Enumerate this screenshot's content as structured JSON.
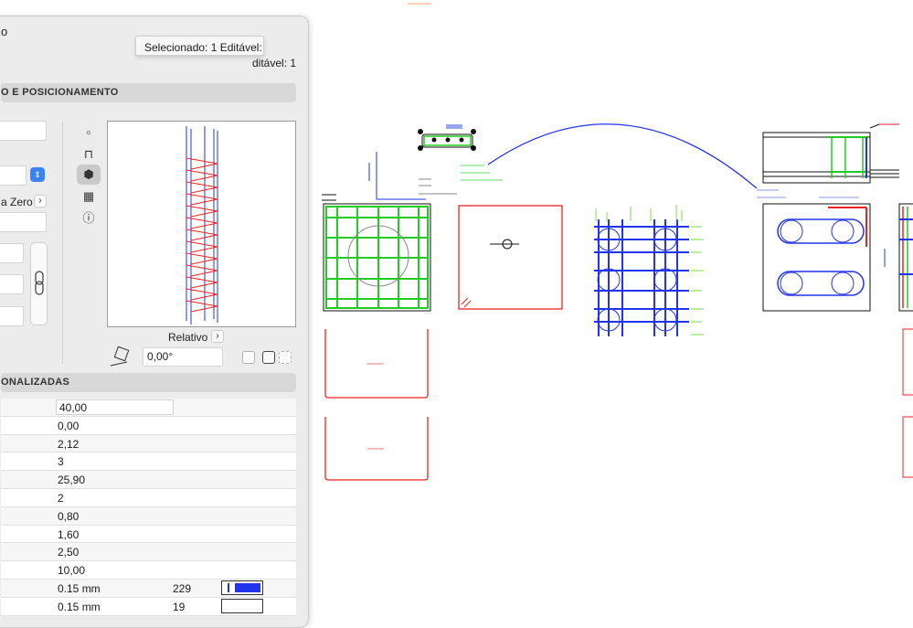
{
  "palette": {
    "window": "#ececec",
    "header": "#d8d8d8",
    "rebar_blue": "#2233ee",
    "rebar_green": "#22cc22",
    "rebar_red": "#ee2222"
  },
  "panel": {
    "title": "o",
    "tooltip": "Selecionado: 1 Editável:",
    "editable_status": "ditável: 1",
    "section_positioning": "O E POSICIONAMENTO",
    "set_zero_label": "a Zero",
    "relative_label": "Relativo",
    "angle_value": "0,00°",
    "section_custom": "ONALIZADAS",
    "toolbar_icons": [
      "square-icon",
      "floor-plan-icon",
      "3d-cube-icon",
      "film-icon",
      "info-icon"
    ],
    "fields": {
      "f1": "",
      "f2": "",
      "f3": "",
      "f4": "",
      "f5": "",
      "f6": ""
    },
    "partial_label": "%)",
    "rows": [
      {
        "value": "40,00",
        "num": "",
        "pen": ""
      },
      {
        "value": "0,00",
        "num": "",
        "pen": ""
      },
      {
        "value": "2,12",
        "num": "",
        "pen": ""
      },
      {
        "value": "3",
        "num": "",
        "pen": ""
      },
      {
        "value": "25,90",
        "num": "",
        "pen": ""
      },
      {
        "value": "2",
        "num": "",
        "pen": ""
      },
      {
        "value": "0,80",
        "num": "",
        "pen": ""
      },
      {
        "value": "1,60",
        "num": "",
        "pen": ""
      },
      {
        "value": "2,50",
        "num": "",
        "pen": ""
      },
      {
        "value": "10,00",
        "num": "",
        "pen": ""
      },
      {
        "value": "0.15 mm",
        "num": "229",
        "pen": "blue"
      },
      {
        "value": "0.15 mm",
        "num": "19",
        "pen": "white"
      }
    ]
  }
}
